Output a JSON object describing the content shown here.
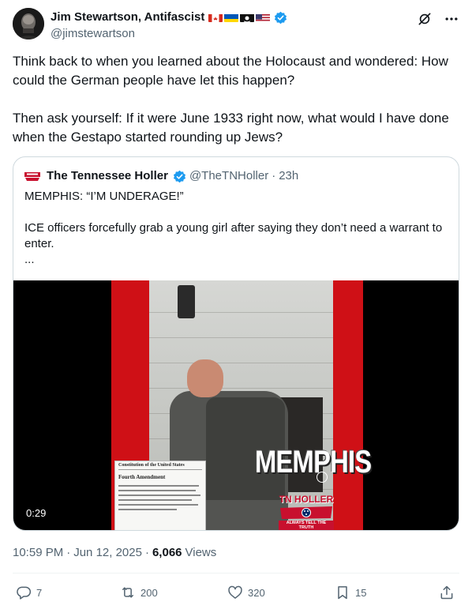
{
  "author": {
    "display_name": "Jim Stewartson, Antifascist",
    "handle": "@jimstewartson",
    "flags": [
      "canada-flag",
      "ukraine-flag",
      "pirate-flag",
      "usa-flag"
    ],
    "verified_color": "#1d9bf0"
  },
  "tweet": {
    "paragraph_1": "Think back to when you learned about the Holocaust and wondered: How could the German people have let this happen?",
    "paragraph_2": "Then ask yourself: If it were June 1933 right now, what would I have done when the Gestapo started rounding up Jews?"
  },
  "quote": {
    "name": "The Tennessee Holler",
    "handle": "@TheTNHoller",
    "separator": "·",
    "time": "23h",
    "line_1": "MEMPHIS: “I’M UNDERAGE!”",
    "line_2": "ICE officers forcefully grab a young girl after saying they don’t need a warrant to enter.",
    "line_3": "...",
    "video": {
      "overlay_text": "MEMPHIS",
      "watermark_text": "TN HOLLER",
      "watermark_tagline": "ALWAYS TELL THE TRUTH",
      "doc_title": "Constitution of the United States",
      "doc_heading": "Fourth Amendment",
      "duration": "0:29"
    }
  },
  "meta": {
    "time": "10:59 PM",
    "separator_1": "·",
    "date": "Jun 12, 2025",
    "separator_2": "·",
    "views_count": "6,066",
    "views_label": "Views"
  },
  "actions": {
    "replies": "7",
    "reposts": "200",
    "likes": "320",
    "bookmarks": "15"
  },
  "colors": {
    "text_primary": "#0f1419",
    "text_secondary": "#536471",
    "border": "#cfd9de",
    "accent": "#1d9bf0",
    "video_red": "#cf1016"
  }
}
